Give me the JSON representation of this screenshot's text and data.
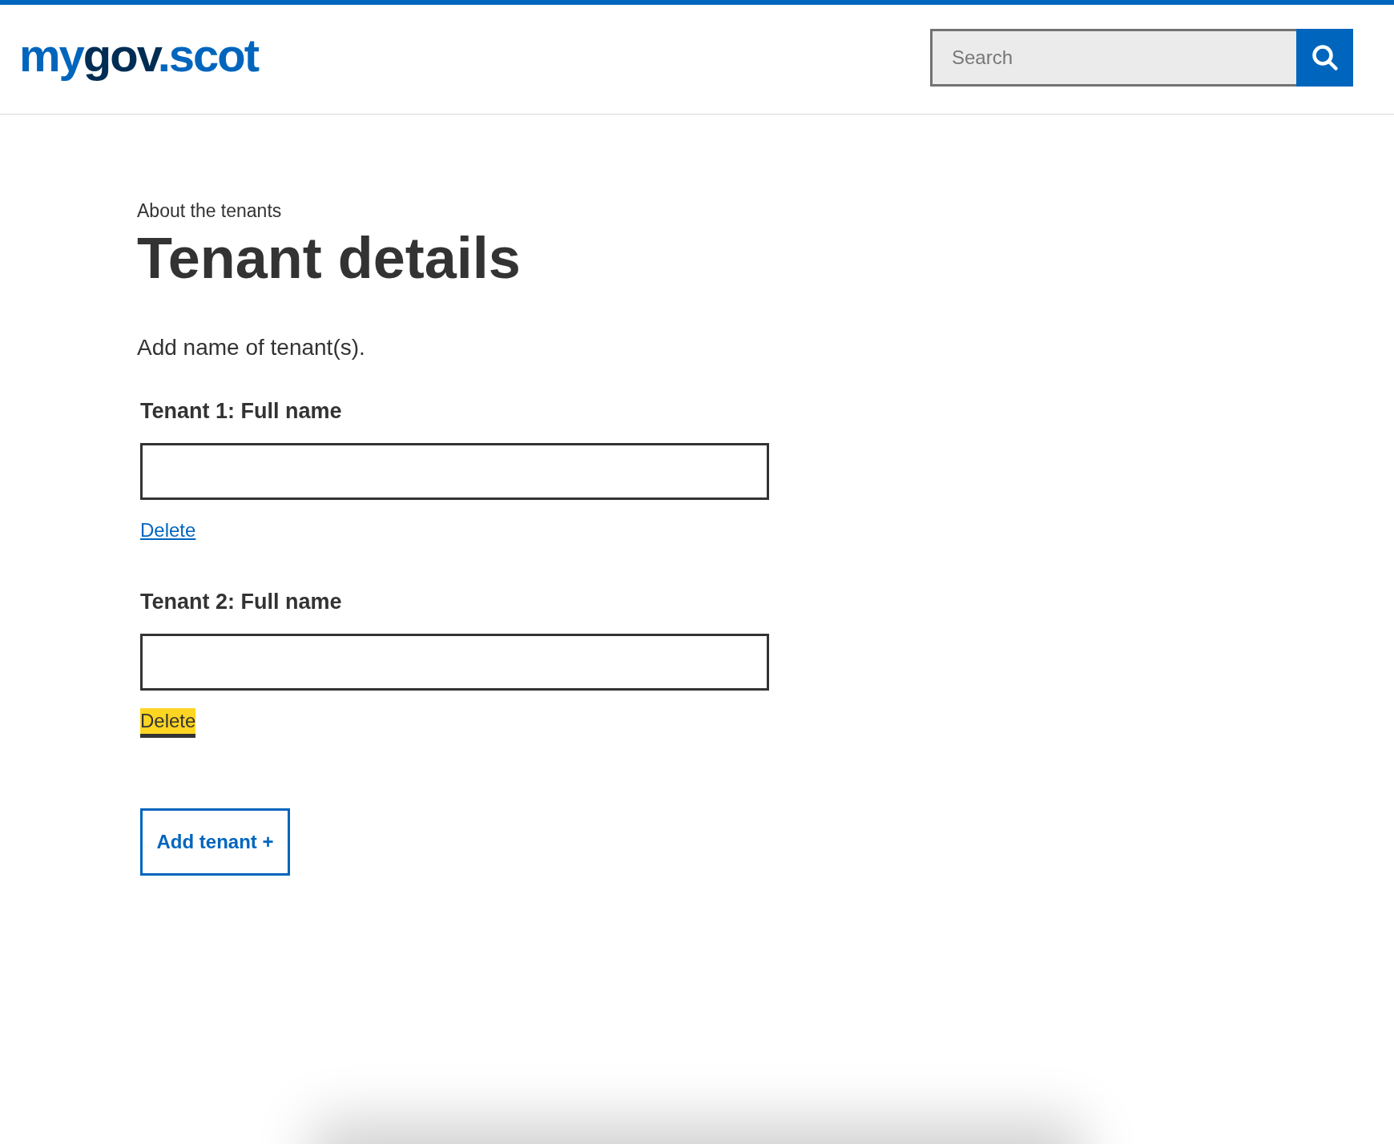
{
  "header": {
    "logo": [
      {
        "text": "my",
        "color": "#0065bd"
      },
      {
        "text": "gov",
        "color": "#002d54"
      },
      {
        "text": ".scot",
        "color": "#0065bd"
      }
    ],
    "search": {
      "placeholder": "Search"
    }
  },
  "page": {
    "caption": "About the tenants",
    "title": "Tenant details",
    "intro": "Add name of tenant(s).",
    "tenants": [
      {
        "label": "Tenant 1: Full name",
        "delete": "Delete",
        "focused": false
      },
      {
        "label": "Tenant 2: Full name",
        "delete": "Delete",
        "focused": true
      }
    ],
    "add_button": "Add tenant +"
  }
}
